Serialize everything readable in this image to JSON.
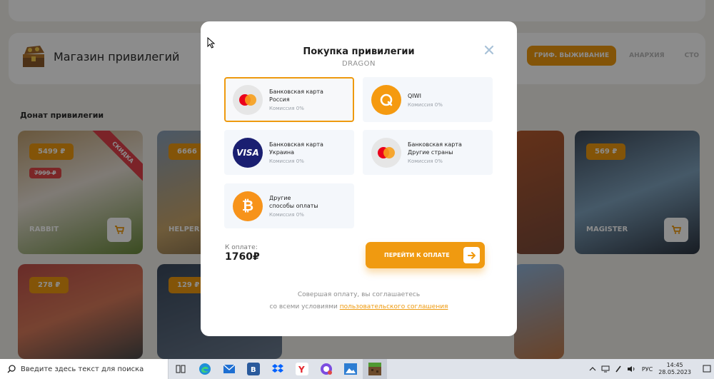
{
  "header": {
    "shop_title": "Магазин привилегий",
    "tabs": [
      {
        "label": "ГРИФ. ВЫЖИВАНИЕ",
        "active": true
      },
      {
        "label": "АНАРХИЯ",
        "active": false
      },
      {
        "label": "СТО",
        "active": false
      }
    ]
  },
  "section_title": "Донат привилегии",
  "cards": [
    {
      "price": "5499 ₽",
      "old_price": "7999 ₽",
      "name": "RABBIT",
      "badge": "СКИДКА"
    },
    {
      "price": "6666",
      "name": "HELPER"
    },
    {
      "price": "569 ₽",
      "name": "MAGISTER"
    },
    {
      "price": "278 ₽"
    },
    {
      "price": "129 ₽"
    }
  ],
  "modal": {
    "title": "Покупка привилегии",
    "subtitle": "DRAGON",
    "payment_options": [
      {
        "line1": "Банковская карта",
        "line2": "Россия",
        "fee": "Комиссия 0%",
        "icon": "mastercard-icon",
        "selected": true
      },
      {
        "line1": "QIWI",
        "line2": "",
        "fee": "Комиссия 0%",
        "icon": "qiwi-icon",
        "selected": false
      },
      {
        "line1": "Банковская карта",
        "line2": "Украина",
        "fee": "Комиссия 0%",
        "icon": "visa-icon",
        "selected": false
      },
      {
        "line1": "Банковская карта",
        "line2": "Другие страны",
        "fee": "Комиссия 0%",
        "icon": "mastercard-icon",
        "selected": false
      },
      {
        "line1": "Другие",
        "line2": "способы оплаты",
        "fee": "Комиссия 0%",
        "icon": "bitcoin-icon",
        "selected": false
      }
    ],
    "total_label": "К оплате:",
    "total_value": "1760₽",
    "pay_button": "ПЕРЕЙТИ К ОПЛАТЕ",
    "agreement_line1": "Совершая оплату, вы соглашаетесь",
    "agreement_line2_prefix": "со всеми условиями ",
    "agreement_link": "пользовательского соглашения"
  },
  "taskbar": {
    "search_placeholder": "Введите здесь текст для поиска",
    "language": "РУС",
    "time": "14:45",
    "date": "28.05.2023"
  },
  "colors": {
    "accent": "#ee9a0f",
    "sale": "#e0404a",
    "visa": "#1a1f71",
    "bitcoin": "#f7931a"
  }
}
